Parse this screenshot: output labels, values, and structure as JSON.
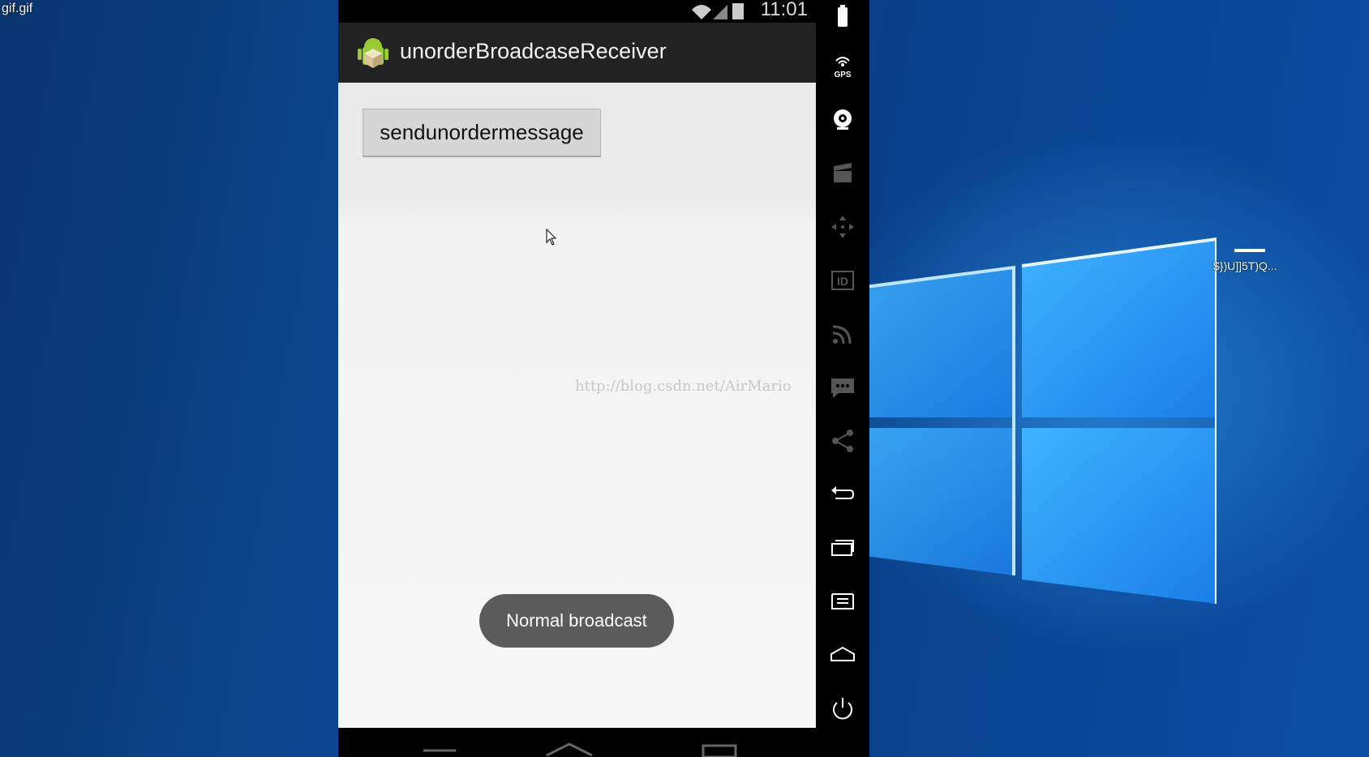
{
  "desktop": {
    "window_label": "gif.gif",
    "icon_label": "$})U]]5T)Q..."
  },
  "emulator": {
    "status_bar": {
      "time": "11:01"
    },
    "action_bar": {
      "title": "unorderBroadcaseReceiver"
    },
    "content": {
      "button_label": "sendunordermessage",
      "watermark": "http://blog.csdn.net/AirMario",
      "toast": "Normal broadcast"
    },
    "side_panel": {
      "gps_label": "GPS",
      "id_label": "ID",
      "buttons": [
        "battery-icon",
        "gps-icon",
        "camera-icon",
        "media-icon",
        "dpad-icon",
        "id-icon",
        "rss-icon",
        "sms-icon",
        "share-icon",
        "back-icon",
        "recents-icon",
        "menu-icon",
        "home-icon",
        "power-icon"
      ]
    }
  },
  "colors": {
    "action_bar": "#222222",
    "toast": "#5b5b5b",
    "desktop_blue": "#0b4fa5"
  }
}
